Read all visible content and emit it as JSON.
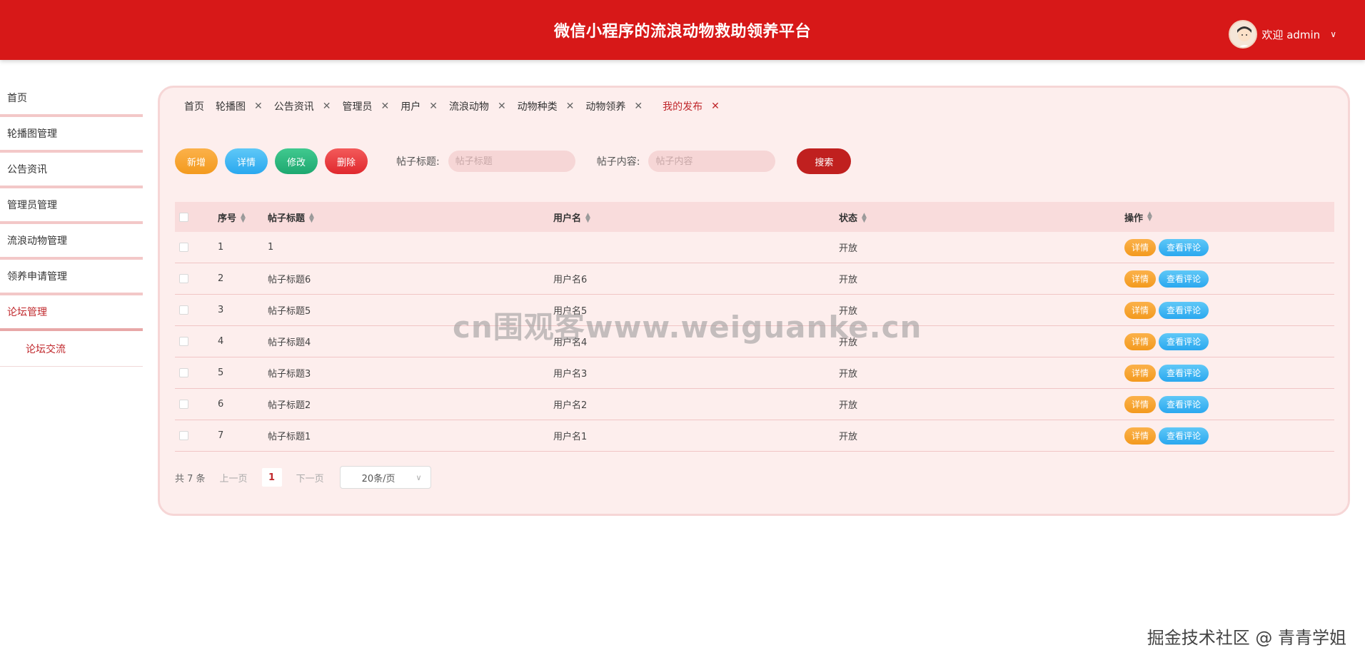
{
  "header": {
    "title": "微信小程序的流浪动物救助领养平台",
    "welcome": "欢迎 admin",
    "accent_color": "#d71818"
  },
  "sidebar": {
    "items": [
      {
        "label": "首页"
      },
      {
        "label": "轮播图管理"
      },
      {
        "label": "公告资讯"
      },
      {
        "label": "管理员管理"
      },
      {
        "label": "流浪动物管理"
      },
      {
        "label": "领养申请管理"
      },
      {
        "label": "论坛管理"
      }
    ],
    "sub_items": [
      {
        "label": "论坛交流"
      }
    ]
  },
  "tabs": [
    {
      "label": "首页"
    },
    {
      "label": "轮播图"
    },
    {
      "label": "公告资讯"
    },
    {
      "label": "管理员"
    },
    {
      "label": "用户"
    },
    {
      "label": "流浪动物"
    },
    {
      "label": "动物种类"
    },
    {
      "label": "动物领养"
    },
    {
      "label": "我的发布"
    }
  ],
  "toolbar": {
    "add": "新增",
    "detail": "详情",
    "edit": "修改",
    "delete": "删除",
    "title_label": "帖子标题:",
    "title_placeholder": "帖子标题",
    "content_label": "帖子内容:",
    "content_placeholder": "帖子内容",
    "search": "搜索"
  },
  "table": {
    "columns": [
      "序号",
      "帖子标题",
      "用户名",
      "状态",
      "操作"
    ],
    "rows": [
      {
        "no": "1",
        "title": "1",
        "user": "",
        "status": "开放"
      },
      {
        "no": "2",
        "title": "帖子标题6",
        "user": "用户名6",
        "status": "开放"
      },
      {
        "no": "3",
        "title": "帖子标题5",
        "user": "用户名5",
        "status": "开放"
      },
      {
        "no": "4",
        "title": "帖子标题4",
        "user": "用户名4",
        "status": "开放"
      },
      {
        "no": "5",
        "title": "帖子标题3",
        "user": "用户名3",
        "status": "开放"
      },
      {
        "no": "6",
        "title": "帖子标题2",
        "user": "用户名2",
        "status": "开放"
      },
      {
        "no": "7",
        "title": "帖子标题1",
        "user": "用户名1",
        "status": "开放"
      }
    ],
    "op_detail": "详情",
    "op_comment": "查看评论"
  },
  "pager": {
    "total": "共 7 条",
    "prev": "上一页",
    "current": "1",
    "next": "下一页",
    "page_size": "20条/页"
  },
  "watermark": "cn围观客www.weiguanke.cn",
  "footnote": "掘金技术社区 @ 青青学姐"
}
